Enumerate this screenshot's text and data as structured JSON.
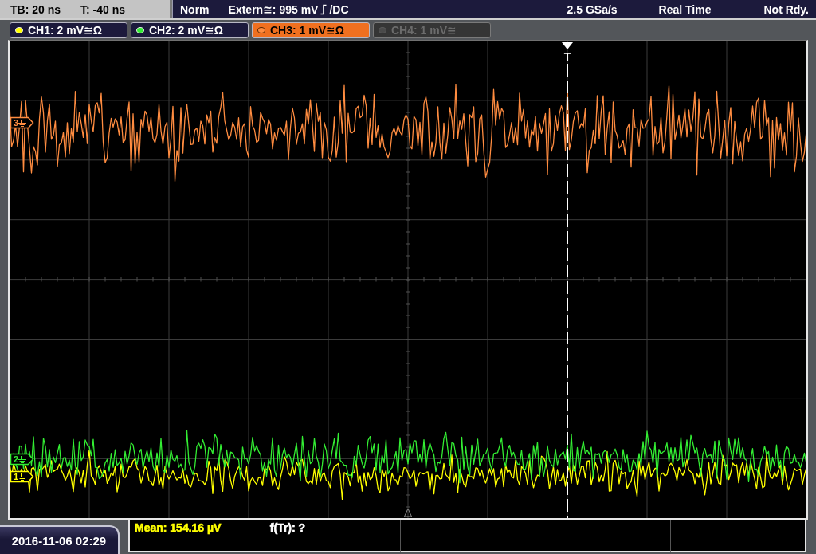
{
  "timebase": {
    "scale": "TB: 20 ns",
    "offset": "T: -40 ns"
  },
  "trigger_bar": {
    "mode": "Norm",
    "source": "Extern≅: 995 mV",
    "coupling": "/DC",
    "sample_rate": "2.5 GSa/s",
    "acquisition": "Real Time",
    "status": "Not Rdy."
  },
  "channels": [
    {
      "label": "CH1: 2 mV≅Ω",
      "color": "#ffff00",
      "on": true,
      "selected": false
    },
    {
      "label": "CH2: 2 mV≅Ω",
      "color": "#33ee33",
      "on": true,
      "selected": false
    },
    {
      "label": "CH3: 1 mV≅Ω",
      "color": "#ff8c40",
      "on": true,
      "selected": true
    },
    {
      "label": "CH4: 1 mV≅",
      "color": "#4a4a4a",
      "on": false,
      "selected": false
    }
  ],
  "trigger": {
    "label": "T"
  },
  "markers": [
    {
      "label": "3",
      "color": "#ff8c40"
    },
    {
      "label": "2",
      "color": "#33ee33"
    },
    {
      "label": "1",
      "color": "#ffff00"
    }
  ],
  "date_time": "2016-11-06 02:29",
  "measurements": [
    {
      "text": "Mean: 154.16 µV",
      "color": "#ffff00"
    },
    {
      "text": "f(Tr): ?",
      "color": "#ffffff"
    }
  ]
}
